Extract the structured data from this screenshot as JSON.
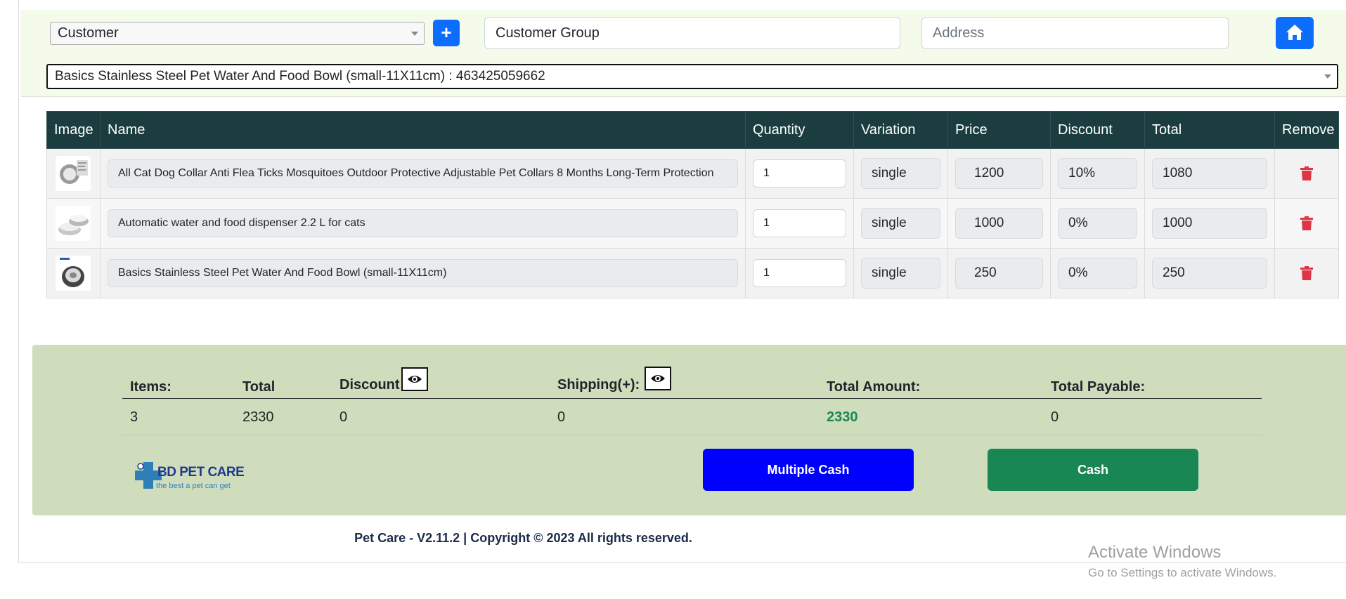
{
  "header": {
    "customer_select": "Customer",
    "add_button": "+",
    "customer_group_value": "Customer Group",
    "address_placeholder": "Address",
    "product_select": "Basics Stainless Steel Pet Water And Food Bowl (small-11X11cm) : 463425059662"
  },
  "table": {
    "columns": [
      "Image",
      "Name",
      "Quantity",
      "Variation",
      "Price",
      "Discount",
      "Total",
      "Remove"
    ],
    "rows": [
      {
        "name": "All Cat Dog Collar Anti Flea Ticks Mosquitoes Outdoor Protective Adjustable Pet Collars 8 Months Long-Term Protection",
        "quantity": "1",
        "variation": "single",
        "price": "1200",
        "discount": "10%",
        "total": "1080"
      },
      {
        "name": "Automatic water and food dispenser 2.2 L for cats",
        "quantity": "1",
        "variation": "single",
        "price": "1000",
        "discount": "0%",
        "total": "1000"
      },
      {
        "name": "Basics Stainless Steel Pet Water And Food Bowl (small-11X11cm)",
        "quantity": "1",
        "variation": "single",
        "price": "250",
        "discount": "0%",
        "total": "250"
      }
    ]
  },
  "summary": {
    "items_label": "Items:",
    "total_label": "Total",
    "discount_label": "Discount",
    "shipping_label": "Shipping(+):",
    "total_amount_label": "Total Amount:",
    "total_payable_label": "Total Payable:",
    "items_value": "3",
    "total_value": "2330",
    "discount_value": "0",
    "shipping_value": "0",
    "total_amount_value": "2330",
    "total_payable_value": "0",
    "total_amount_color": "#198754"
  },
  "actions": {
    "multiple_cash": "Multiple Cash",
    "cash": "Cash"
  },
  "logo": {
    "title": "BD PET CARE",
    "tagline": "the best a pet can get"
  },
  "footer": "Pet Care - V2.11.2 | Copyright © 2023 All rights reserved.",
  "watermark": {
    "line1": "Activate Windows",
    "line2": "Go to Settings to activate Windows."
  },
  "colors": {
    "primary": "#0d6efd",
    "table_header": "#1b3d3f",
    "summary_bg": "#cfddbd",
    "remove_icon": "#dc3545",
    "multiple_cash_bg": "#0000ff",
    "cash_bg": "#198754"
  }
}
